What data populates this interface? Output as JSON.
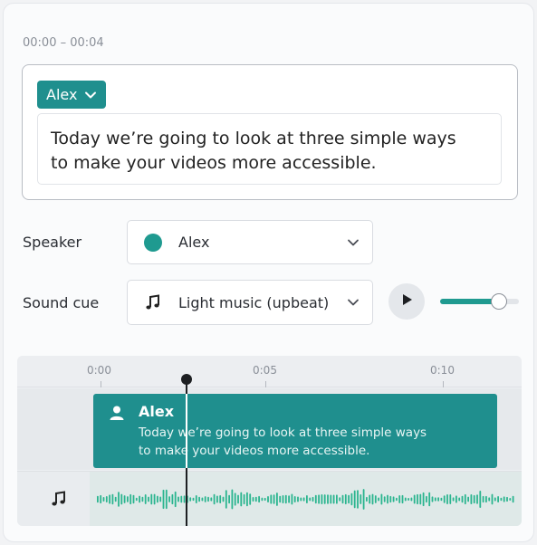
{
  "time_range": "00:00 – 00:04",
  "caption": {
    "speaker": "Alex",
    "lines": [
      "Today we’re going to look at three simple ways",
      "to make your videos more accessible."
    ]
  },
  "speaker_row": {
    "label": "Speaker",
    "value": "Alex",
    "color": "#1f9a90"
  },
  "sound_row": {
    "label": "Sound cue",
    "value": "Light music (upbeat)",
    "volume": 0.75
  },
  "timeline": {
    "ticks": [
      "0:00",
      "0:05",
      "0:10"
    ],
    "playhead_time": "0:02.5",
    "clip": {
      "speaker": "Alex",
      "lines": [
        "Today we’re going to look at three simple ways",
        "to make your videos more accessible."
      ]
    }
  },
  "colors": {
    "accent": "#1f8f8e",
    "wave": "#2bb58f"
  },
  "icons": [
    "chevron-down-icon",
    "music-note-icon",
    "play-icon",
    "user-icon"
  ]
}
